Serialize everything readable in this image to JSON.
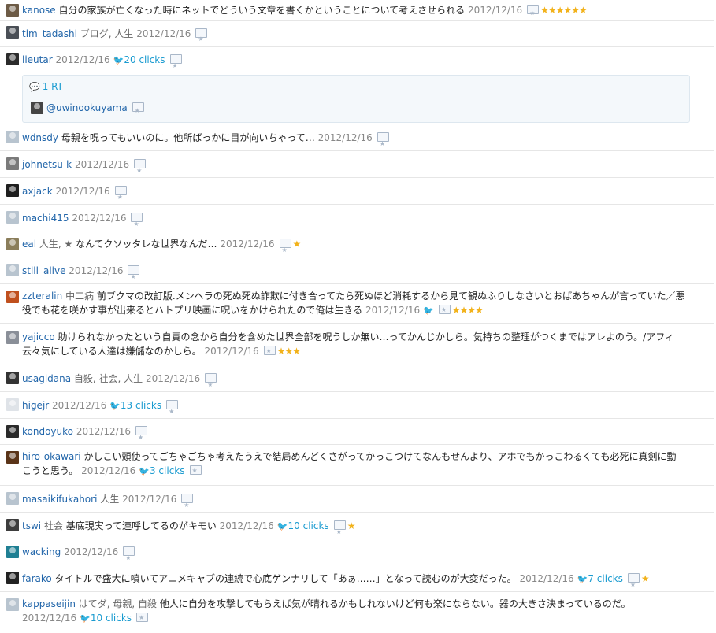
{
  "rows": [
    {
      "user": "kanose",
      "comment": "自分の家族が亡くなった時にネットでどういう文章を書くかということについて考えさせられる",
      "date": "2012/12/16",
      "stars": "★★★★★★",
      "avatar_color": "#6d5b46"
    },
    {
      "user": "tim_tadashi",
      "tags": "ブログ, 人生",
      "date": "2012/12/16",
      "avatar_color": "#4a4f56"
    },
    {
      "user": "lieutar",
      "date": "2012/12/16",
      "clicks": "20 clicks",
      "rt_count": "1 RT",
      "rt_user": "@uwinookuyama",
      "avatar_color": "#2b2b2b"
    },
    {
      "user": "wdnsdy",
      "comment": "母親を呪ってもいいのに。他所ばっかに目が向いちゃって…",
      "date": "2012/12/16",
      "avatar_color": "#b8c4cf"
    },
    {
      "user": "johnetsu-k",
      "date": "2012/12/16",
      "avatar_color": "#7a7a7a"
    },
    {
      "user": "axjack",
      "date": "2012/12/16",
      "avatar_color": "#1e1e1e"
    },
    {
      "user": "machi415",
      "date": "2012/12/16",
      "avatar_color": "#b8c4cf"
    },
    {
      "user": "eal",
      "tags": "人生, ★",
      "comment": "なんてクソッタレな世界なんだ…",
      "date": "2012/12/16",
      "stars": "★",
      "avatar_color": "#8a7d5a"
    },
    {
      "user": "still_alive",
      "date": "2012/12/16",
      "avatar_color": "#b8c4cf"
    },
    {
      "user": "zzteralin",
      "tags": "中二病",
      "comment": "前ブクマの改訂版.メンヘラの死ぬ死ぬ詐欺に付き合ってたら死ぬほど消耗するから見て観ぬふりしなさいとおばあちゃんが言っていた／悪役でも花を咲かす事が出来るとハトプリ映画に呪いをかけられたので俺は生きる",
      "date": "2012/12/16",
      "stars": "★★★★",
      "avatar_color": "#c0501e"
    },
    {
      "user": "yajicco",
      "comment": "助けられなかったという自責の念から自分を含めた世界全部を呪うしか無い…ってかんじかしら。気持ちの整理がつくまではアレよのう。/アフィ云々気にしている人達は嫌儲なのかしら。",
      "date": "2012/12/16",
      "stars": "★★★",
      "avatar_color": "#8a8f98"
    },
    {
      "user": "usagidana",
      "tags": "自殺, 社会, 人生",
      "date": "2012/12/16",
      "avatar_color": "#333333"
    },
    {
      "user": "higejr",
      "date": "2012/12/16",
      "clicks": "13 clicks",
      "avatar_color": "#dfe3e8"
    },
    {
      "user": "kondoyuko",
      "date": "2012/12/16",
      "avatar_color": "#2a2a2a"
    },
    {
      "user": "hiro-okawari",
      "comment": "かしこい頭使ってごちゃごちゃ考えたうえで結局めんどくさがってかっこつけてなんもせんより、アホでもかっこわるくても必死に真剣に動こうと思う。",
      "date": "2012/12/16",
      "clicks": "3 clicks",
      "avatar_color": "#5a3418"
    },
    {
      "user": "masaikifukahori",
      "tags": "人生",
      "date": "2012/12/16",
      "avatar_color": "#b8c4cf"
    },
    {
      "user": "tswi",
      "tags": "社会",
      "comment": "基底現実って連呼してるのがキモい",
      "date": "2012/12/16",
      "clicks": "10 clicks",
      "stars": "★",
      "avatar_color": "#3d3d3d"
    },
    {
      "user": "wacking",
      "date": "2012/12/16",
      "avatar_color": "#1f7f93"
    },
    {
      "user": "farako",
      "comment": "タイトルで盛大に噴いてアニメキャブの連続で心底ゲンナリして「あぁ……」となって読むのが大変だった。",
      "date": "2012/12/16",
      "clicks": "7 clicks",
      "stars": "★",
      "avatar_color": "#222222"
    },
    {
      "user": "kappaseijin",
      "tags": "はてダ, 母親, 自殺",
      "comment": "他人に自分を攻撃してもらえば気が晴れるかもしれないけど何も楽にならない。器の大きさ決まっているのだ。",
      "date": "2012/12/16",
      "clicks": "10 clicks",
      "avatar_color": "#b8c4cf"
    }
  ]
}
